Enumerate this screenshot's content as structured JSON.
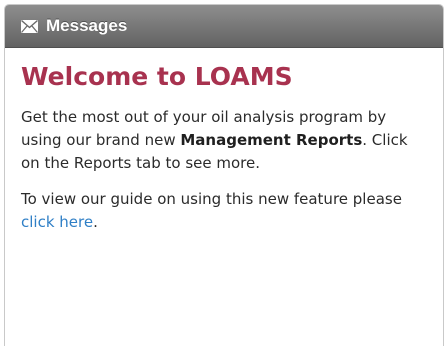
{
  "panel": {
    "header": {
      "icon": "envelope-icon",
      "title": "Messages"
    },
    "title": "Welcome to LOAMS",
    "paragraph1": {
      "text_before": "Get the most out of your oil analysis program by using our brand new ",
      "bold": "Management Reports",
      "text_after": ". Click on the Reports tab to see more."
    },
    "paragraph2": {
      "text_before": "To view our guide on using this new feature please ",
      "link_text": "click here",
      "text_after": "."
    }
  },
  "colors": {
    "title": "#a8324f",
    "link": "#2f7fc6",
    "header_bg": "#7a7a7a"
  }
}
